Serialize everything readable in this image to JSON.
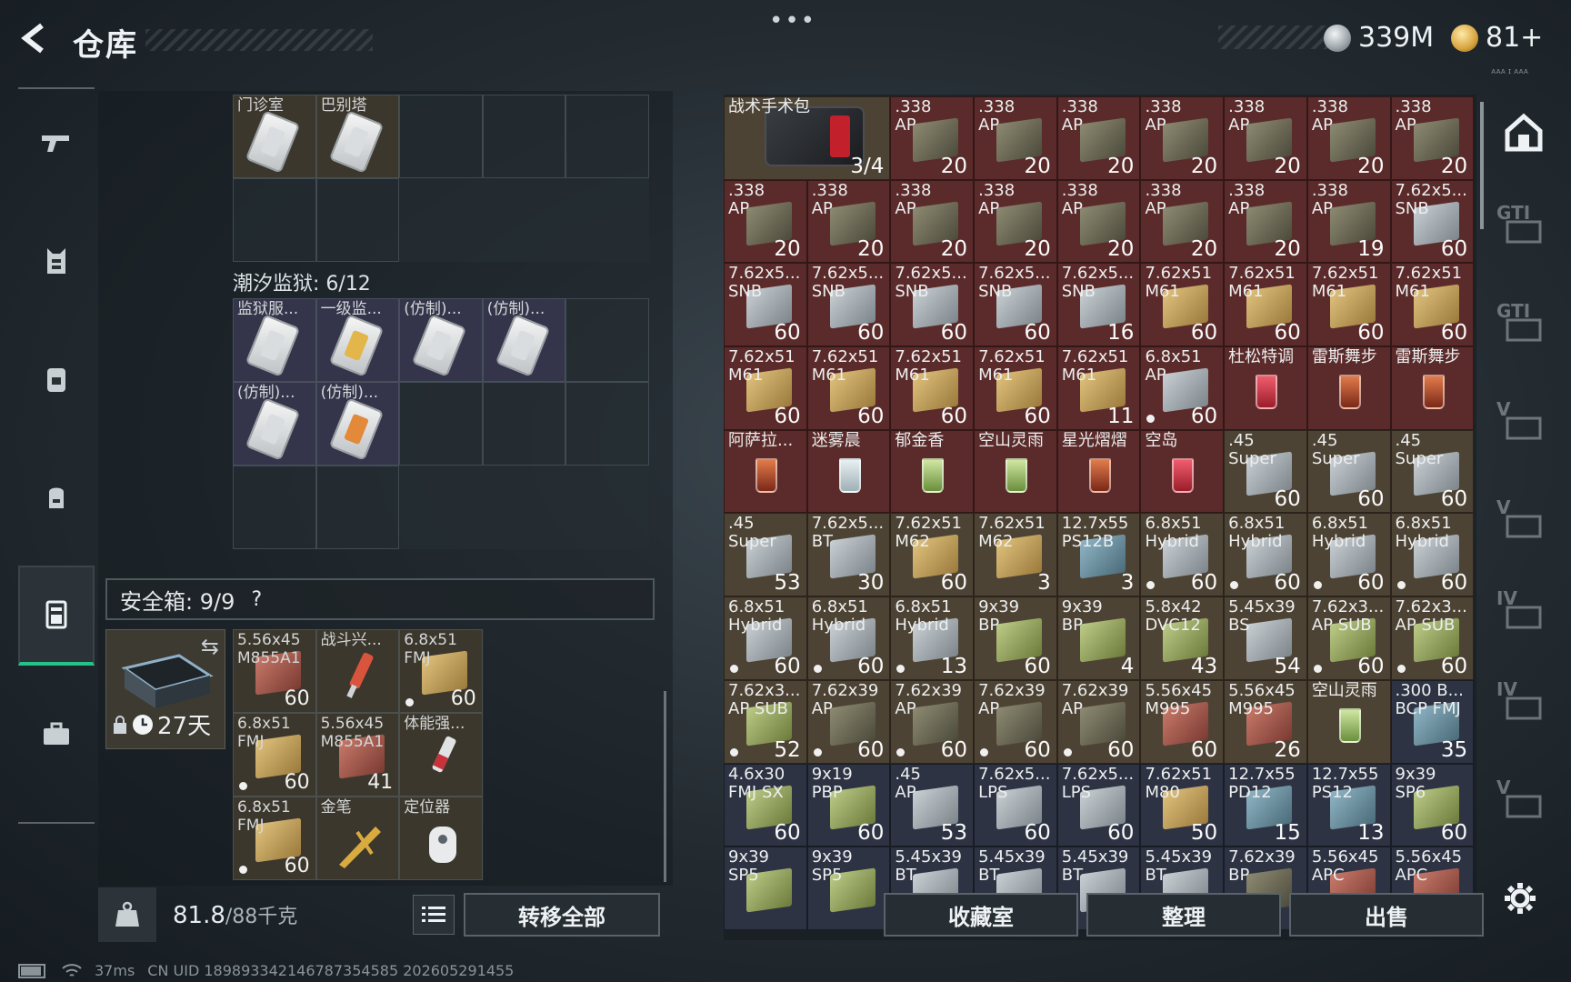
{
  "header": {
    "title": "仓库",
    "menu": "•••",
    "currency1": "339M",
    "currency2": "81+",
    "tiny_code": "ᴀᴀᴀ ɪ ᴀᴀᴀ"
  },
  "colors": {
    "accent": "#25c28a",
    "slot_red": "#5b2a2a",
    "slot_gold": "#4d4334",
    "slot_blue": "#2e3344"
  },
  "sidebar": {
    "items": [
      {
        "name": "weapons",
        "icon": "gun-icon"
      },
      {
        "name": "armor",
        "icon": "vest-icon"
      },
      {
        "name": "backpack",
        "icon": "backpack-icon"
      },
      {
        "name": "bag",
        "icon": "pouch-icon"
      },
      {
        "name": "container",
        "icon": "case-icon",
        "active": true
      },
      {
        "name": "briefcase",
        "icon": "briefcase-icon"
      }
    ]
  },
  "keycards_top": {
    "items": [
      {
        "label": "门诊室"
      },
      {
        "label": "巴别塔"
      }
    ]
  },
  "tidal_prison": {
    "label": "潮汐监狱: 6/12",
    "items": [
      {
        "label": "监狱服..."
      },
      {
        "label": "一级监..."
      },
      {
        "label": "(仿制)..."
      },
      {
        "label": "(仿制)..."
      },
      {
        "label": "(仿制)..."
      },
      {
        "label": "(仿制)..."
      }
    ]
  },
  "safe_box": {
    "label": "安全箱: 9/9",
    "help": "?",
    "days": "27天",
    "items": [
      {
        "l1": "5.56x45",
        "l2": "M855A1",
        "count": "60",
        "color": "redb"
      },
      {
        "l1": "战斗兴...",
        "l2": "",
        "count": "",
        "color": "injector"
      },
      {
        "l1": "6.8x51",
        "l2": "FMJ",
        "count": "60",
        "dot": true,
        "color": "tan"
      },
      {
        "l1": "6.8x51",
        "l2": "FMJ",
        "count": "60",
        "dot": true,
        "color": "tan"
      },
      {
        "l1": "5.56x45",
        "l2": "M855A1",
        "count": "41",
        "color": "redb"
      },
      {
        "l1": "体能强...",
        "l2": "",
        "count": "",
        "color": "injector"
      },
      {
        "l1": "6.8x51",
        "l2": "FMJ",
        "count": "60",
        "dot": true,
        "color": "tan"
      },
      {
        "l1": "金笔",
        "l2": "",
        "count": "",
        "color": "gold"
      },
      {
        "l1": "定位器",
        "l2": "",
        "count": "",
        "color": "grey"
      }
    ]
  },
  "bottom_left": {
    "weight": "81.8",
    "weight_max": "/88千克",
    "transfer_all": "转移全部"
  },
  "actions": {
    "vault": "收藏室",
    "sort": "整理",
    "sell": "出售"
  },
  "status": {
    "ping": "37ms",
    "uid": "CN UID 18989334214678735458​5 202605291455"
  },
  "right_side": {
    "items": [
      {
        "name": "warehouse",
        "icon": "warehouse-icon",
        "active": true
      },
      {
        "name": "gti-1",
        "text": "GTI"
      },
      {
        "name": "gti-2",
        "text": "GTI"
      },
      {
        "name": "v-1",
        "text": "V"
      },
      {
        "name": "v-2",
        "text": "V"
      },
      {
        "name": "iv-1",
        "text": "IV"
      },
      {
        "name": "iv-2",
        "text": "IV"
      },
      {
        "name": "v-3",
        "text": "V"
      }
    ]
  },
  "inventory": [
    {
      "l1": "战术手术包",
      "l2": "",
      "count": "3/4",
      "bg": "gold",
      "type": "bag",
      "span": 2
    },
    {
      "l1": ".338",
      "l2": "AP",
      "count": "20",
      "bg": "red",
      "type": "olive"
    },
    {
      "l1": ".338",
      "l2": "AP",
      "count": "20",
      "bg": "red",
      "type": "olive"
    },
    {
      "l1": ".338",
      "l2": "AP",
      "count": "20",
      "bg": "red",
      "type": "olive"
    },
    {
      "l1": ".338",
      "l2": "AP",
      "count": "20",
      "bg": "red",
      "type": "olive"
    },
    {
      "l1": ".338",
      "l2": "AP",
      "count": "20",
      "bg": "red",
      "type": "olive"
    },
    {
      "l1": ".338",
      "l2": "AP",
      "count": "20",
      "bg": "red",
      "type": "olive"
    },
    {
      "l1": ".338",
      "l2": "AP",
      "count": "20",
      "bg": "red",
      "type": "olive"
    },
    {
      "l1": ".338",
      "l2": "AP",
      "count": "20",
      "bg": "red",
      "type": "olive"
    },
    {
      "l1": ".338",
      "l2": "AP",
      "count": "20",
      "bg": "red",
      "type": "olive"
    },
    {
      "l1": ".338",
      "l2": "AP",
      "count": "20",
      "bg": "red",
      "type": "olive"
    },
    {
      "l1": ".338",
      "l2": "AP",
      "count": "20",
      "bg": "red",
      "type": "olive"
    },
    {
      "l1": ".338",
      "l2": "AP",
      "count": "20",
      "bg": "red",
      "type": "olive"
    },
    {
      "l1": ".338",
      "l2": "AP",
      "count": "20",
      "bg": "red",
      "type": "olive"
    },
    {
      "l1": ".338",
      "l2": "AP",
      "count": "20",
      "bg": "red",
      "type": "olive"
    },
    {
      "l1": ".338",
      "l2": "AP",
      "count": "19",
      "bg": "red",
      "type": "olive"
    },
    {
      "l1": "7.62x5...",
      "l2": "SNB",
      "count": "60",
      "bg": "red",
      "type": "grey"
    },
    {
      "l1": "7.62x5...",
      "l2": "SNB",
      "count": "60",
      "bg": "red",
      "type": "grey"
    },
    {
      "l1": "7.62x5...",
      "l2": "SNB",
      "count": "60",
      "bg": "red",
      "type": "grey"
    },
    {
      "l1": "7.62x5...",
      "l2": "SNB",
      "count": "60",
      "bg": "red",
      "type": "grey"
    },
    {
      "l1": "7.62x5...",
      "l2": "SNB",
      "count": "60",
      "bg": "red",
      "type": "grey"
    },
    {
      "l1": "7.62x5...",
      "l2": "SNB",
      "count": "16",
      "bg": "red",
      "type": "grey"
    },
    {
      "l1": "7.62x51",
      "l2": "M61",
      "count": "60",
      "bg": "red",
      "type": "tan"
    },
    {
      "l1": "7.62x51",
      "l2": "M61",
      "count": "60",
      "bg": "red",
      "type": "tan"
    },
    {
      "l1": "7.62x51",
      "l2": "M61",
      "count": "60",
      "bg": "red",
      "type": "tan"
    },
    {
      "l1": "7.62x51",
      "l2": "M61",
      "count": "60",
      "bg": "red",
      "type": "tan"
    },
    {
      "l1": "7.62x51",
      "l2": "M61",
      "count": "60",
      "bg": "red",
      "type": "tan"
    },
    {
      "l1": "7.62x51",
      "l2": "M61",
      "count": "60",
      "bg": "red",
      "type": "tan"
    },
    {
      "l1": "7.62x51",
      "l2": "M61",
      "count": "60",
      "bg": "red",
      "type": "tan"
    },
    {
      "l1": "7.62x51",
      "l2": "M61",
      "count": "60",
      "bg": "red",
      "type": "tan"
    },
    {
      "l1": "7.62x51",
      "l2": "M61",
      "count": "11",
      "bg": "red",
      "type": "tan"
    },
    {
      "l1": "6.8x51",
      "l2": "AP",
      "count": "60",
      "dot": true,
      "bg": "red",
      "type": "grey"
    },
    {
      "l1": "杜松特调",
      "l2": "",
      "count": "",
      "bg": "red",
      "type": "drink-red"
    },
    {
      "l1": "雷斯舞步",
      "l2": "",
      "count": "",
      "bg": "red",
      "type": "drink"
    },
    {
      "l1": "雷斯舞步",
      "l2": "",
      "count": "",
      "bg": "red",
      "type": "drink"
    },
    {
      "l1": "阿萨拉...",
      "l2": "",
      "count": "",
      "bg": "red",
      "type": "drink"
    },
    {
      "l1": "迷雾晨",
      "l2": "",
      "count": "",
      "bg": "red",
      "type": "drink-clear"
    },
    {
      "l1": "郁金香",
      "l2": "",
      "count": "",
      "bg": "red",
      "type": "drink-green"
    },
    {
      "l1": "空山灵雨",
      "l2": "",
      "count": "",
      "bg": "red",
      "type": "drink-green"
    },
    {
      "l1": "星光熠熠",
      "l2": "",
      "count": "",
      "bg": "red",
      "type": "drink"
    },
    {
      "l1": "空岛",
      "l2": "",
      "count": "",
      "bg": "red",
      "type": "drink-red"
    },
    {
      "l1": ".45",
      "l2": "Super",
      "count": "60",
      "bg": "gold",
      "type": "grey"
    },
    {
      "l1": ".45",
      "l2": "Super",
      "count": "60",
      "bg": "gold",
      "type": "grey"
    },
    {
      "l1": ".45",
      "l2": "Super",
      "count": "60",
      "bg": "gold",
      "type": "grey"
    },
    {
      "l1": ".45",
      "l2": "Super",
      "count": "53",
      "bg": "gold",
      "type": "grey"
    },
    {
      "l1": "7.62x5...",
      "l2": "BT",
      "count": "30",
      "bg": "gold",
      "type": "grey"
    },
    {
      "l1": "7.62x51",
      "l2": "M62",
      "count": "60",
      "bg": "gold",
      "type": "tan"
    },
    {
      "l1": "7.62x51",
      "l2": "M62",
      "count": "3",
      "bg": "gold",
      "type": "tan"
    },
    {
      "l1": "12.7x55",
      "l2": "PS12B",
      "count": "3",
      "bg": "gold",
      "type": "teal"
    },
    {
      "l1": "6.8x51",
      "l2": "Hybrid",
      "count": "60",
      "dot": true,
      "bg": "gold",
      "type": "grey"
    },
    {
      "l1": "6.8x51",
      "l2": "Hybrid",
      "count": "60",
      "dot": true,
      "bg": "gold",
      "type": "grey"
    },
    {
      "l1": "6.8x51",
      "l2": "Hybrid",
      "count": "60",
      "dot": true,
      "bg": "gold",
      "type": "grey"
    },
    {
      "l1": "6.8x51",
      "l2": "Hybrid",
      "count": "60",
      "dot": true,
      "bg": "gold",
      "type": "grey"
    },
    {
      "l1": "6.8x51",
      "l2": "Hybrid",
      "count": "60",
      "dot": true,
      "bg": "gold",
      "type": "grey"
    },
    {
      "l1": "6.8x51",
      "l2": "Hybrid",
      "count": "60",
      "dot": true,
      "bg": "gold",
      "type": "grey"
    },
    {
      "l1": "6.8x51",
      "l2": "Hybrid",
      "count": "13",
      "dot": true,
      "bg": "gold",
      "type": "grey"
    },
    {
      "l1": "9x39",
      "l2": "BP",
      "count": "60",
      "bg": "gold",
      "type": "green"
    },
    {
      "l1": "9x39",
      "l2": "BP",
      "count": "4",
      "bg": "gold",
      "type": "green"
    },
    {
      "l1": "5.8x42",
      "l2": "DVC12",
      "count": "43",
      "bg": "gold",
      "type": "green"
    },
    {
      "l1": "5.45x39",
      "l2": "BS",
      "count": "54",
      "bg": "gold",
      "type": "grey"
    },
    {
      "l1": "7.62x3...",
      "l2": "AP SUB",
      "count": "60",
      "dot": true,
      "bg": "gold",
      "type": "green"
    },
    {
      "l1": "7.62x3...",
      "l2": "AP SUB",
      "count": "60",
      "dot": true,
      "bg": "gold",
      "type": "green"
    },
    {
      "l1": "7.62x3...",
      "l2": "AP SUB",
      "count": "52",
      "dot": true,
      "bg": "gold",
      "type": "green"
    },
    {
      "l1": "7.62x39",
      "l2": "AP",
      "count": "60",
      "dot": true,
      "bg": "gold",
      "type": "olive"
    },
    {
      "l1": "7.62x39",
      "l2": "AP",
      "count": "60",
      "dot": true,
      "bg": "gold",
      "type": "olive"
    },
    {
      "l1": "7.62x39",
      "l2": "AP",
      "count": "60",
      "dot": true,
      "bg": "gold",
      "type": "olive"
    },
    {
      "l1": "7.62x39",
      "l2": "AP",
      "count": "60",
      "dot": true,
      "bg": "gold",
      "type": "olive"
    },
    {
      "l1": "5.56x45",
      "l2": "M995",
      "count": "60",
      "bg": "gold",
      "type": "redb"
    },
    {
      "l1": "5.56x45",
      "l2": "M995",
      "count": "26",
      "bg": "gold",
      "type": "redb"
    },
    {
      "l1": "空山灵雨",
      "l2": "",
      "count": "",
      "bg": "gold",
      "type": "drink-green"
    },
    {
      "l1": ".300 B...",
      "l2": "BCP FMJ",
      "count": "35",
      "bg": "blue",
      "type": "teal"
    },
    {
      "l1": "4.6x30",
      "l2": "FMJ SX",
      "count": "60",
      "bg": "blue",
      "type": "green"
    },
    {
      "l1": "9x19",
      "l2": "PBP",
      "count": "60",
      "bg": "blue",
      "type": "green"
    },
    {
      "l1": ".45",
      "l2": "AP",
      "count": "53",
      "bg": "blue",
      "type": "grey"
    },
    {
      "l1": "7.62x5...",
      "l2": "LPS",
      "count": "60",
      "bg": "blue",
      "type": "grey"
    },
    {
      "l1": "7.62x5...",
      "l2": "LPS",
      "count": "60",
      "bg": "blue",
      "type": "grey"
    },
    {
      "l1": "7.62x51",
      "l2": "M80",
      "count": "50",
      "bg": "blue",
      "type": "tan"
    },
    {
      "l1": "12.7x55",
      "l2": "PD12",
      "count": "15",
      "bg": "blue",
      "type": "teal"
    },
    {
      "l1": "12.7x55",
      "l2": "PS12",
      "count": "13",
      "bg": "blue",
      "type": "teal"
    },
    {
      "l1": "9x39",
      "l2": "SP6",
      "count": "60",
      "bg": "blue",
      "type": "green"
    },
    {
      "l1": "9x39",
      "l2": "SP5",
      "count": "",
      "bg": "blue",
      "type": "green"
    },
    {
      "l1": "9x39",
      "l2": "SP5",
      "count": "",
      "bg": "blue",
      "type": "green"
    },
    {
      "l1": "5.45x39",
      "l2": "BT",
      "count": "",
      "bg": "blue",
      "type": "grey"
    },
    {
      "l1": "5.45x39",
      "l2": "BT",
      "count": "",
      "bg": "blue",
      "type": "grey"
    },
    {
      "l1": "5.45x39",
      "l2": "BT",
      "count": "",
      "bg": "blue",
      "type": "grey"
    },
    {
      "l1": "5.45x39",
      "l2": "BT",
      "count": "",
      "bg": "blue",
      "type": "grey"
    },
    {
      "l1": "7.62x39",
      "l2": "BP",
      "count": "",
      "bg": "blue",
      "type": "olive"
    },
    {
      "l1": "5.56x45",
      "l2": "APC",
      "count": "",
      "bg": "blue",
      "type": "redb"
    },
    {
      "l1": "5.56x45",
      "l2": "APC",
      "count": "",
      "bg": "blue",
      "type": "redb"
    }
  ]
}
